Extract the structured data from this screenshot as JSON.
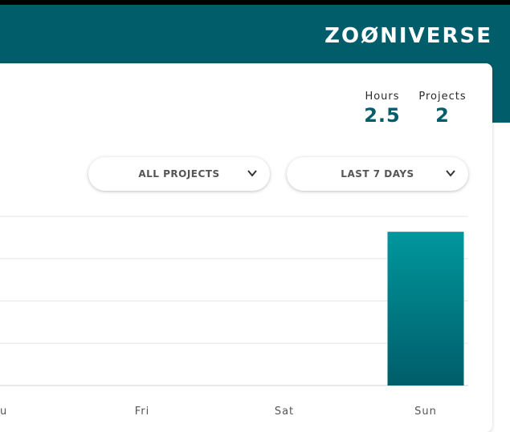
{
  "brand": {
    "logo_text": "ZOØNIVERSE"
  },
  "stats": {
    "hours_label": "Hours",
    "hours_value": "2.5",
    "projects_label": "Projects",
    "projects_value": "2"
  },
  "filters": {
    "project_select": {
      "selected": "ALL PROJECTS",
      "icon": "chevron-down-icon"
    },
    "range_select": {
      "selected": "LAST 7 DAYS",
      "icon": "chevron-down-icon"
    }
  },
  "colors": {
    "brand_teal": "#005d69",
    "bar_top": "#00979d",
    "bar_bottom": "#005d69"
  },
  "chart_data": {
    "type": "bar",
    "categories": [
      "hu",
      "Fri",
      "Sat",
      "Sun"
    ],
    "values": [
      0,
      0,
      0,
      1
    ],
    "ylim": [
      0,
      1.1
    ],
    "grid": true
  }
}
